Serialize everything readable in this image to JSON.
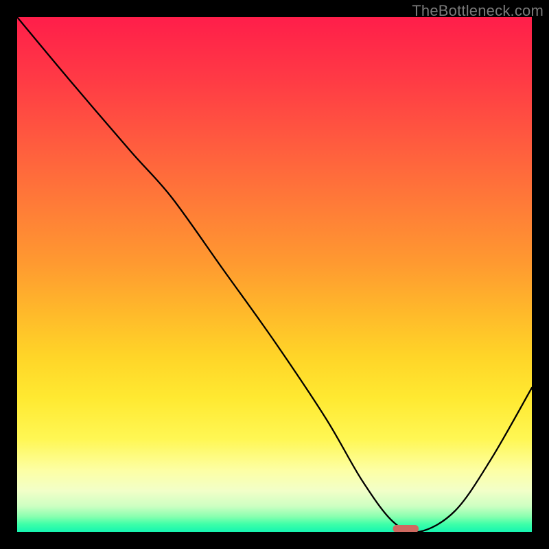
{
  "watermark": "TheBottleneck.com",
  "chart_data": {
    "type": "line",
    "title": "",
    "xlabel": "",
    "ylabel": "",
    "xlim": [
      0,
      100
    ],
    "ylim": [
      0,
      100
    ],
    "grid": false,
    "background_gradient": {
      "top_color": "#ff1e4a",
      "bottom_color": "#16f5b0",
      "meaning": "red=high bottleneck, green=low bottleneck"
    },
    "series": [
      {
        "name": "bottleneck-curve",
        "x": [
          0,
          10,
          22,
          30,
          40,
          50,
          60,
          67,
          73,
          78,
          85,
          92,
          100
        ],
        "y": [
          100,
          88,
          74,
          65,
          51,
          37,
          22,
          10,
          2,
          0,
          4,
          14,
          28
        ],
        "note": "y is percent height from bottom; curve descends from top-left, small knee near x≈22, bottoms out near x≈73-78 at y≈0, then rises toward right edge"
      }
    ],
    "marker": {
      "name": "optimal-point",
      "x": 75.5,
      "y": 0,
      "width_pct": 5,
      "color": "#cf6a61",
      "shape": "rounded-bar"
    }
  }
}
